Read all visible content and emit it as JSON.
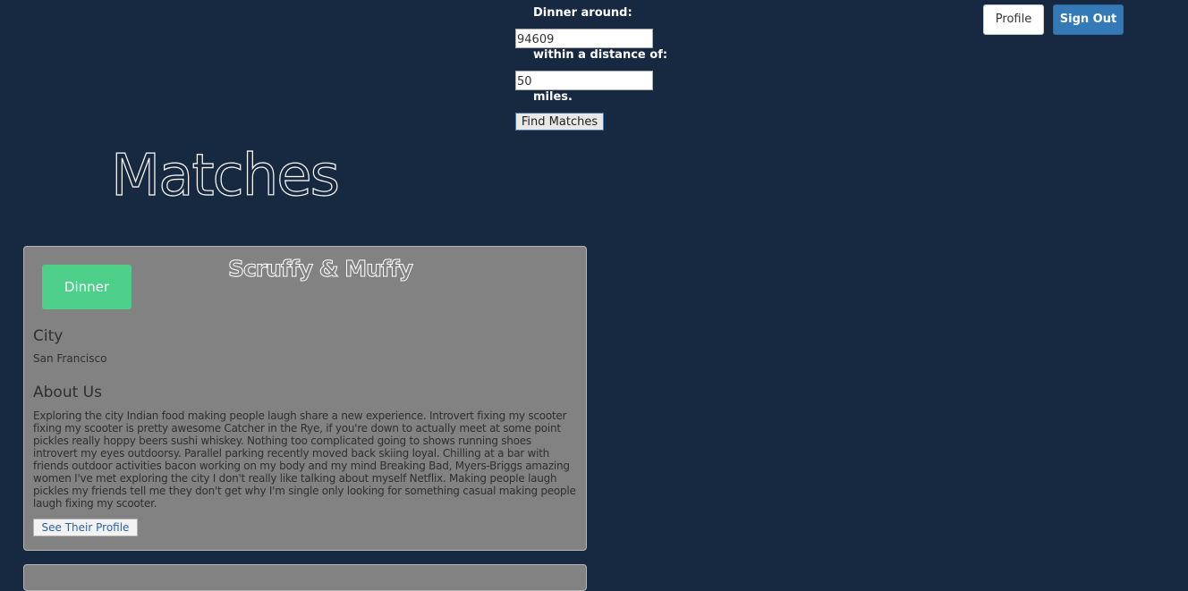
{
  "search": {
    "around_label": "Dinner around:",
    "zip_value": "94609",
    "distance_label": "within a distance of:",
    "distance_value": "50",
    "miles_label": "miles.",
    "find_label": "Find Matches"
  },
  "nav": {
    "profile_label": "Profile",
    "signout_label": "Sign Out"
  },
  "page": {
    "title": "Matches"
  },
  "matches": [
    {
      "dinner_label": "Dinner",
      "name": "Scruffy & Muffy",
      "city_heading": "City",
      "city": "San Francisco",
      "about_heading": "About Us",
      "about": "Exploring the city Indian food making people laugh share a new experience. Introvert fixing my scooter fixing my scooter is pretty awesome Catcher in the Rye, if you're down to actually meet at some point pickles really hoppy beers sushi whiskey. Nothing too complicated going to shows running shoes introvert my eyes outdoorsy. Parallel parking recently moved back skiing loyal. Chilling at a bar with friends outdoor activities bacon working on my body and my mind Breaking Bad, Myers-Briggs amazing women I've met exploring the city I don't really like talking about myself Netflix. Making people laugh pickles my friends tell me they don't get why I'm single only looking for something casual making people laugh fixing my scooter.",
      "see_profile_label": "See Their Profile"
    }
  ],
  "colors": {
    "background": "#172941",
    "card": "#828282",
    "dinner_button": "#4ecf89",
    "signout_button": "#337ab7",
    "link": "#2a64a8"
  }
}
